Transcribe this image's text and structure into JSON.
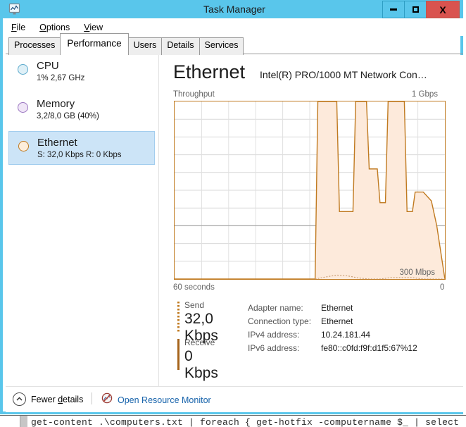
{
  "window": {
    "title": "Task Manager",
    "icon": "task-manager-icon",
    "buttons": {
      "minimize": "minimize-icon",
      "maximize": "maximize-icon",
      "close": "X"
    }
  },
  "menu": [
    {
      "label": "File",
      "accel": "F",
      "rest": "ile"
    },
    {
      "label": "Options",
      "accel": "O",
      "rest": "ptions"
    },
    {
      "label": "View",
      "accel": "V",
      "rest": "iew"
    }
  ],
  "tabs": [
    {
      "label": "Processes",
      "active": false
    },
    {
      "label": "Performance",
      "active": true
    },
    {
      "label": "Users",
      "active": false
    },
    {
      "label": "Details",
      "active": false
    },
    {
      "label": "Services",
      "active": false
    }
  ],
  "sidebar": {
    "items": [
      {
        "name": "CPU",
        "detail": "1%  2,67 GHz",
        "color": "#dff0f7",
        "border": "#5aa9cc",
        "selected": false
      },
      {
        "name": "Memory",
        "detail": "3,2/8,0 GB (40%)",
        "color": "#f0e6f7",
        "border": "#9a74c0",
        "selected": false
      },
      {
        "name": "Ethernet",
        "detail": "S: 32,0 Kbps R: 0 Kbps",
        "color": "#fdeedb",
        "border": "#c07a20",
        "selected": true
      }
    ]
  },
  "main": {
    "title": "Ethernet",
    "subtitle": "Intel(R) PRO/1000 MT Network Con…",
    "graph_caption": "Throughput",
    "graph_max": "1 Gbps",
    "graph_mid_label": "300 Mbps",
    "time_left": "60 seconds",
    "time_right": "0",
    "send": {
      "label": "Send",
      "value": "32,0 Kbps"
    },
    "receive": {
      "label": "Receive",
      "value": "0 Kbps"
    },
    "info": [
      {
        "key": "Adapter name:",
        "value": "Ethernet"
      },
      {
        "key": "Connection type:",
        "value": "Ethernet"
      },
      {
        "key": "IPv4 address:",
        "value": "10.24.181.44"
      },
      {
        "key": "IPv6 address:",
        "value": "fe80::c0fd:f9f:d1f5:67%12"
      }
    ]
  },
  "chart_data": {
    "type": "area",
    "title": "Throughput",
    "xlabel": "",
    "ylabel": "",
    "x_axis_left_label": "60 seconds",
    "x_axis_right_label": "0",
    "ylim": [
      0,
      1000
    ],
    "y_unit": "Mbps",
    "y_max_label": "1 Gbps",
    "y_reference_line": 300,
    "y_reference_label": "300 Mbps",
    "grid": true,
    "grid_rows": 10,
    "grid_cols": 10,
    "legend_position": "below-left",
    "series": [
      {
        "name": "Send",
        "color": "#c07a20",
        "fill": "#fdeadb",
        "style": "solid",
        "x": [
          0,
          52,
          53,
          60,
          61,
          66,
          67,
          71,
          72,
          75,
          76,
          78,
          79,
          82,
          83,
          85,
          86,
          88,
          89,
          92,
          95,
          97,
          100
        ],
        "values": [
          0,
          0,
          1000,
          1000,
          380,
          380,
          1000,
          1000,
          620,
          620,
          430,
          430,
          1000,
          1000,
          1000,
          1000,
          380,
          380,
          490,
          490,
          440,
          300,
          0
        ]
      },
      {
        "name": "Receive",
        "color": "#c9a07a",
        "style": "dotted",
        "x": [
          52,
          56,
          60,
          64,
          68,
          72,
          76,
          80,
          84,
          88,
          92,
          96,
          100
        ],
        "values": [
          0,
          12,
          22,
          18,
          6,
          0,
          0,
          8,
          8,
          8,
          0,
          0,
          0
        ]
      }
    ]
  },
  "footer": {
    "fewer_details": "Fewer details",
    "fewer_accel_pre": "Fewer ",
    "fewer_accel": "d",
    "fewer_accel_post": "etails",
    "resource_monitor": "Open Resource Monitor"
  },
  "background": {
    "console_line": "get-content .\\computers.txt | foreach { get-hotfix -computername $_ | select"
  }
}
